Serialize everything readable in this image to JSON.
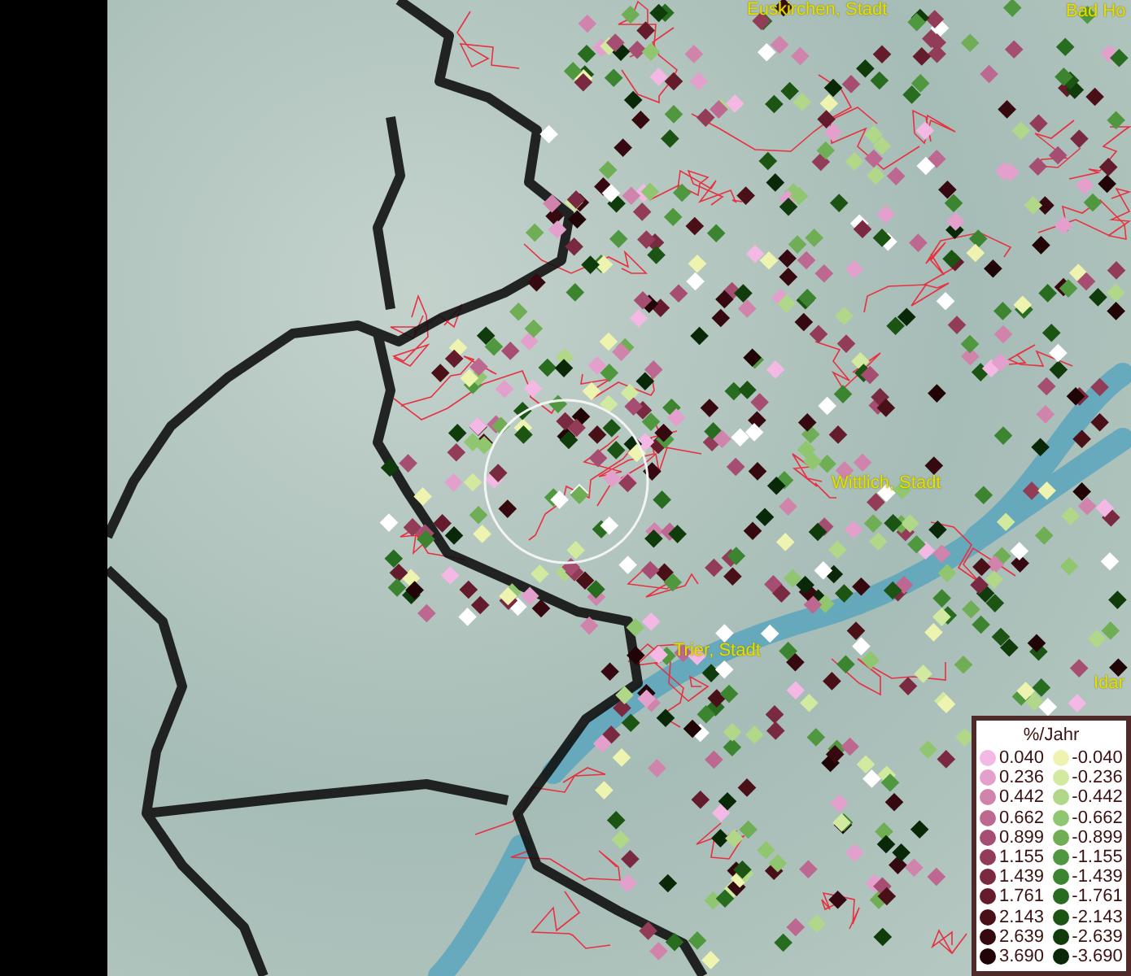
{
  "map": {
    "labels": [
      {
        "text": "Euskirchen, Stadt"
      },
      {
        "text": "Bad Ho"
      },
      {
        "text": "Wittlich, Stadt"
      },
      {
        "text": "Trier, Stadt"
      },
      {
        "text": "Idar"
      }
    ]
  },
  "legend": {
    "title": "%/Jahr",
    "positive": [
      {
        "value": "0.040",
        "color": "#f4b8e4"
      },
      {
        "value": "0.236",
        "color": "#e4a0cc"
      },
      {
        "value": "0.442",
        "color": "#d084ac"
      },
      {
        "value": "0.662",
        "color": "#bc6890"
      },
      {
        "value": "0.899",
        "color": "#a64e72"
      },
      {
        "value": "1.155",
        "color": "#923c58"
      },
      {
        "value": "1.439",
        "color": "#7a2a40"
      },
      {
        "value": "1.761",
        "color": "#641c2c"
      },
      {
        "value": "2.143",
        "color": "#4a1018"
      },
      {
        "value": "2.639",
        "color": "#360810"
      },
      {
        "value": "3.690",
        "color": "#200406"
      }
    ],
    "negative": [
      {
        "value": "-0.040",
        "color": "#eef4b0"
      },
      {
        "value": "-0.236",
        "color": "#d2eaa0"
      },
      {
        "value": "-0.442",
        "color": "#b0d888"
      },
      {
        "value": "-0.662",
        "color": "#90c670"
      },
      {
        "value": "-0.899",
        "color": "#70ae56"
      },
      {
        "value": "-1.155",
        "color": "#509840"
      },
      {
        "value": "-1.439",
        "color": "#3c8430"
      },
      {
        "value": "-1.761",
        "color": "#286c20"
      },
      {
        "value": "-2.143",
        "color": "#1c5414"
      },
      {
        "value": "-2.639",
        "color": "#103c0c"
      },
      {
        "value": "-3.690",
        "color": "#082808"
      }
    ]
  }
}
